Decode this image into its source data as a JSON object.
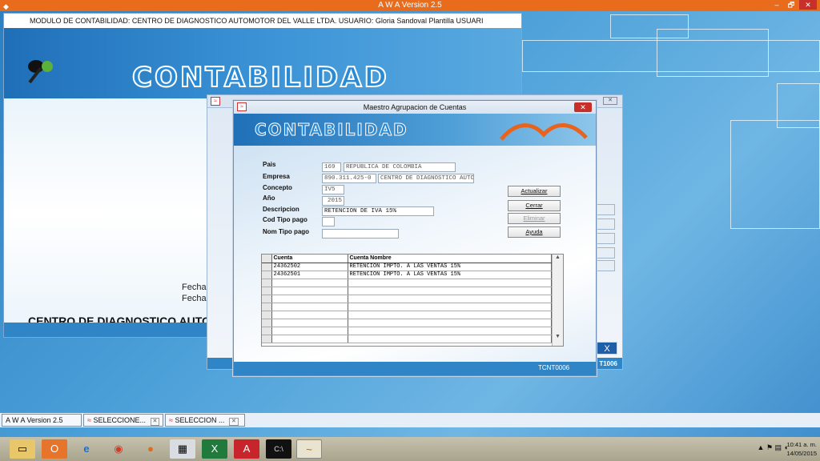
{
  "app": {
    "title": "A W A Version 2.5",
    "window_controls": {
      "minimize": "–",
      "restore": "🗗",
      "close": "✕"
    }
  },
  "module": {
    "header": "MODULO DE CONTABILIDAD: CENTRO DE DIAGNOSTICO AUTOMOTOR DEL VALLE LTDA.    USUARIO:  Gloria Sandoval  Plantilla USUARI",
    "logo_text": "CONTABILIDAD",
    "fecha1": "Fecha",
    "fecha2": "Fecha",
    "company": "CENTRO DE DIAGNOSTICO AUTOI"
  },
  "selecciones": {
    "code": "T1006",
    "x_label": "X"
  },
  "dialog": {
    "title": "Maestro Agrupacion de Cuentas",
    "logo_text": "CONTABILIDAD",
    "footer_code": "TCNT0006",
    "fields": {
      "pais_label": "Pais",
      "pais_code": "169",
      "pais_name": "REPUBLICA DE COLOMBIA",
      "empresa_label": "Empresa",
      "empresa_nit": "890.311.425-0",
      "empresa_name": "CENTRO DE DIAGNOSTICO AUTO",
      "concepto_label": "Concepto",
      "concepto_value": "IV5",
      "anio_label": "Año",
      "anio_value": "2015",
      "descripcion_label": "Descripcion",
      "descripcion_value": "RETENCION DE IVA 15%",
      "cod_tipo_pago_label": "Cod Tipo pago",
      "cod_tipo_pago_value": "",
      "nom_tipo_pago_label": "Nom Tipo  pago",
      "nom_tipo_pago_value": ""
    },
    "buttons": {
      "actualizar": "Actualizar",
      "cerrar": "Cerrar",
      "eliminar": "Eliminar",
      "ayuda": "Ayuda"
    },
    "grid": {
      "headers": [
        "Cuenta",
        "Cuenta Nombre"
      ],
      "rows": [
        [
          "24362502",
          "RETENCIÓN IMPTO. A LAS VENTAS 15%"
        ],
        [
          "24362501",
          "RETENCIÓN IMPTO. A LAS VENTAS 15%"
        ]
      ]
    }
  },
  "app_tabs": [
    {
      "label": "A W A Version 2.5"
    },
    {
      "label": "SELECCIONE..."
    },
    {
      "label": "SELECCION ..."
    }
  ],
  "taskbar": {
    "clock_time": "10:41 a. m.",
    "clock_date": "14/05/2015"
  }
}
